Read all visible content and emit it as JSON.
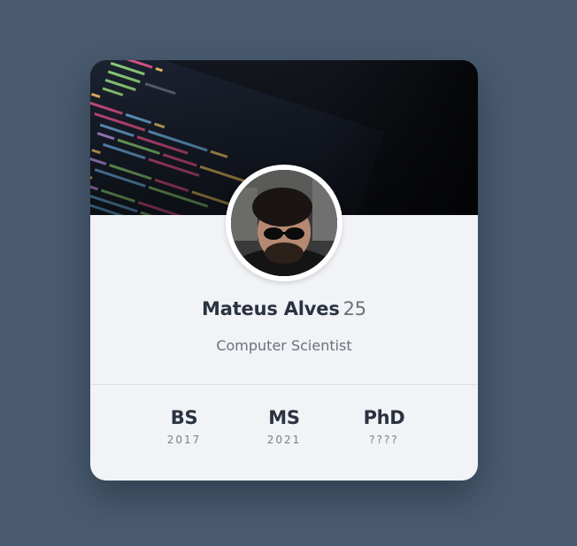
{
  "profile": {
    "name": "Mateus Alves",
    "age": "25",
    "occupation": "Computer Scientist"
  },
  "degrees": [
    {
      "label": "BS",
      "year": "2017"
    },
    {
      "label": "MS",
      "year": "2021"
    },
    {
      "label": "PhD",
      "year": "????"
    }
  ],
  "colors": {
    "background": "#4a5b6f",
    "card": "#f1f3f6",
    "heading": "#2b3240",
    "muted": "#6b717b"
  },
  "icons": {
    "cover": "code-screen-photo",
    "avatar": "person-sunglasses-photo"
  }
}
